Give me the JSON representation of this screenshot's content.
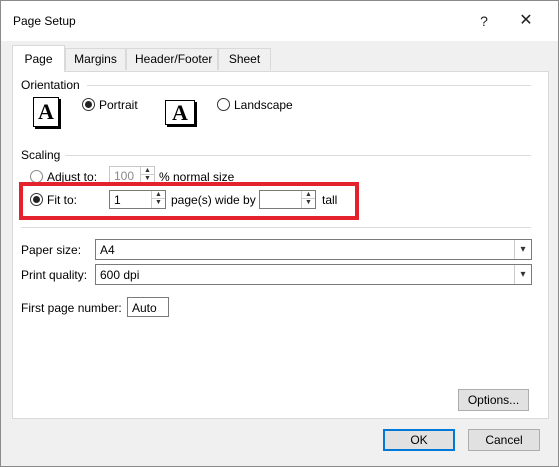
{
  "window": {
    "title": "Page Setup",
    "help_glyph": "?",
    "close_glyph": "✕"
  },
  "tabs": [
    {
      "label": "Page",
      "active": true
    },
    {
      "label": "Margins",
      "active": false
    },
    {
      "label": "Header/Footer",
      "active": false
    },
    {
      "label": "Sheet",
      "active": false
    }
  ],
  "orientation": {
    "heading": "Orientation",
    "icon_letter": "A",
    "portrait_label": "Portrait",
    "landscape_label": "Landscape",
    "selected": "portrait"
  },
  "scaling": {
    "heading": "Scaling",
    "adjust_label": "Adjust to:",
    "adjust_value": "100",
    "adjust_suffix": "% normal size",
    "fit_label": "Fit to:",
    "fit_wide_value": "1",
    "fit_wide_suffix": "page(s) wide by",
    "fit_tall_value": "",
    "fit_tall_suffix": "tall",
    "selected": "fit",
    "highlight_color": "#e4222e"
  },
  "paper": {
    "size_label": "Paper size:",
    "size_value": "A4",
    "quality_label": "Print quality:",
    "quality_value": "600 dpi",
    "first_page_label": "First page number:",
    "first_page_value": "Auto"
  },
  "buttons": {
    "options": "Options...",
    "ok": "OK",
    "cancel": "Cancel"
  },
  "accent_color": "#0078d7"
}
